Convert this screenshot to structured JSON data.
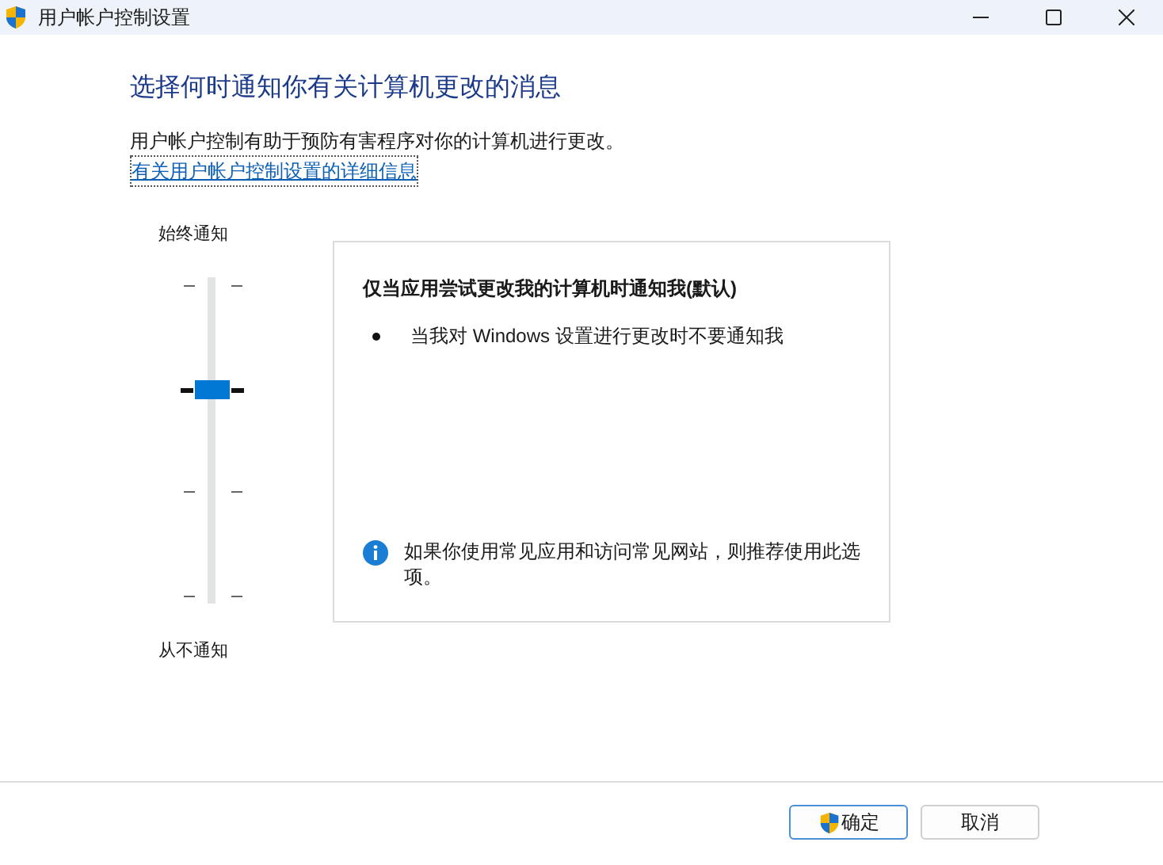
{
  "window": {
    "title": "用户帐户控制设置"
  },
  "heading": "选择何时通知你有关计算机更改的消息",
  "description": "用户帐户控制有助于预防有害程序对你的计算机进行更改。",
  "link": "有关用户帐户控制设置的详细信息",
  "slider": {
    "top_label": "始终通知",
    "bottom_label": "从不通知",
    "level": 0.667
  },
  "card": {
    "title": "仅当应用尝试更改我的计算机时通知我(默认)",
    "bullets": [
      "当我对 Windows 设置进行更改时不要通知我"
    ],
    "note": "如果你使用常见应用和访问常见网站，则推荐使用此选项。"
  },
  "buttons": [
    {
      "label": "确定",
      "kind": "shield"
    },
    {
      "label": "取消",
      "kind": "plain"
    }
  ]
}
